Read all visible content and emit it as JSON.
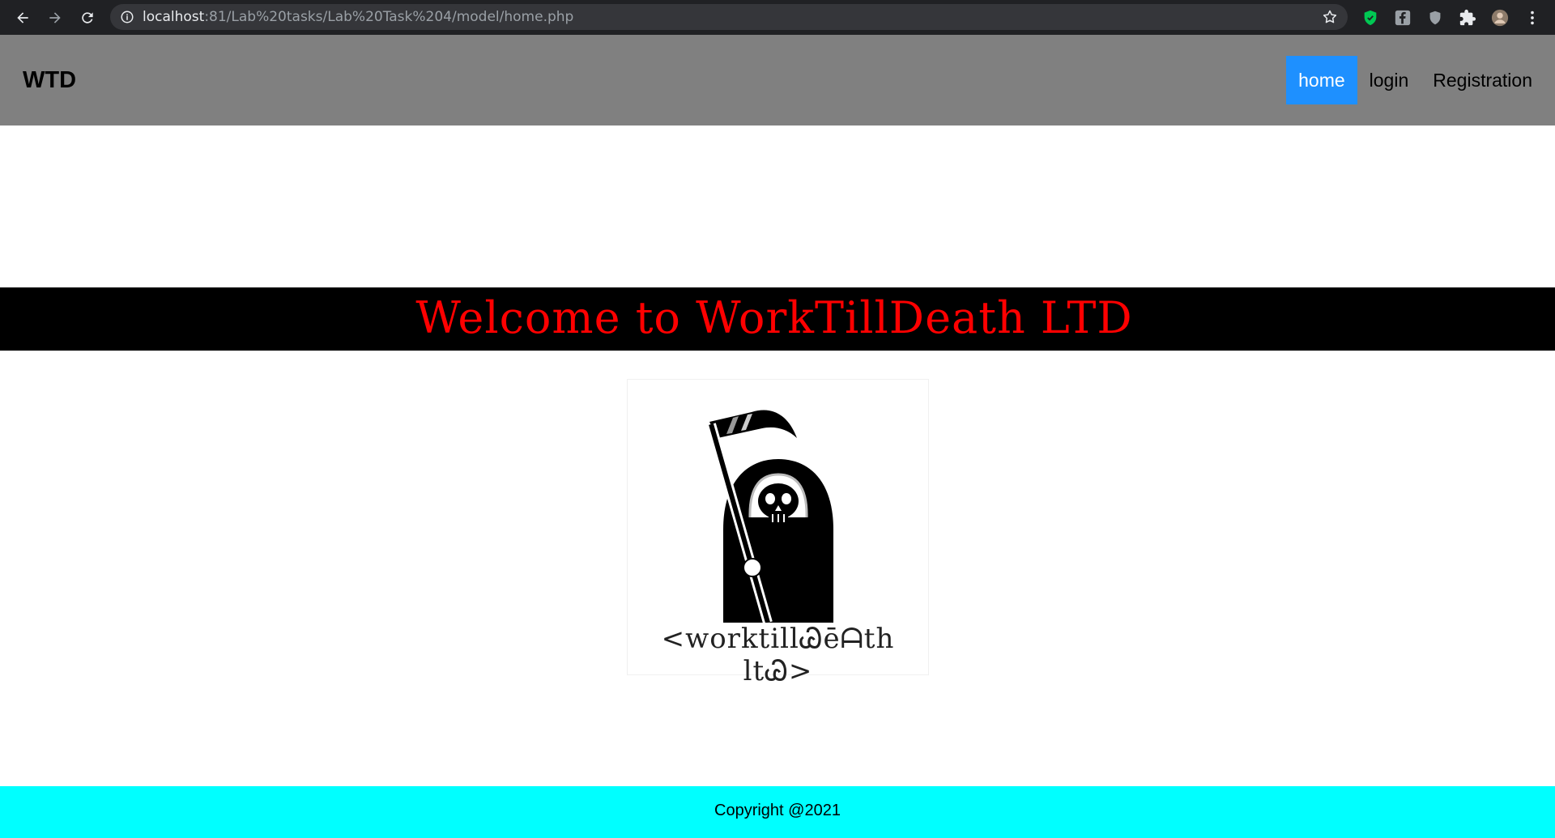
{
  "browser": {
    "url_host": "localhost",
    "url_rest": ":81/Lab%20tasks/Lab%20Task%204/model/home.php",
    "icons": [
      "back-arrow-icon",
      "forward-arrow-icon",
      "reload-icon",
      "info-icon",
      "bookmark-star-icon",
      "shield-extension-icon",
      "facebook-extension-icon",
      "privacy-extension-icon",
      "puzzle-extensions-icon",
      "profile-avatar-icon",
      "kebab-menu-icon"
    ]
  },
  "header": {
    "brand": "WTD",
    "nav": [
      {
        "label": "home",
        "active": true
      },
      {
        "label": "login",
        "active": false
      },
      {
        "label": "Registration",
        "active": false
      }
    ],
    "active_color": "#1e90ff",
    "background": "#808080"
  },
  "banner": {
    "title": "Welcome to WorkTillDeath LTD",
    "text_color": "#ff0000",
    "background": "#000000"
  },
  "logo": {
    "text": "<worktillᏊēᗩth ltᏊ>"
  },
  "footer": {
    "text": "Copyright @2021",
    "background": "#00ffff"
  }
}
